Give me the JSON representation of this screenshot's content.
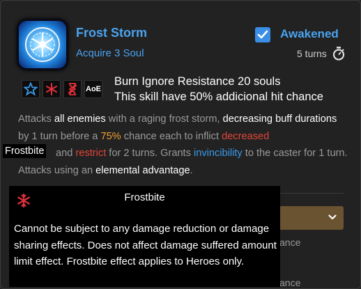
{
  "skill": {
    "name": "Frost Storm",
    "acquire": "Acquire 3 Soul",
    "awakened_label": "Awakened",
    "awakened_checked": true,
    "turns": "5 turns",
    "icon": "frost-snowflake-icon"
  },
  "tags": [
    {
      "name": "freeze-star-icon",
      "label": ""
    },
    {
      "name": "frost-red-icon",
      "label": ""
    },
    {
      "name": "hourglass-icon",
      "label": ""
    },
    {
      "name": "aoe-icon",
      "label": "AoE"
    }
  ],
  "effect": {
    "line1": "Burn Ignore Resistance 20 souls",
    "line2": "This skill have 50% addicional hit chance"
  },
  "description": {
    "t1": "Attacks ",
    "t2": "all enemies",
    "t3": " with a raging frost storm, ",
    "t4": "decreasing buff durations",
    "t5": " by 1 turn before a ",
    "t6": "75%",
    "t7": " chance each to inflict ",
    "t8": "decreased",
    "t9": " and ",
    "t10": "restrict",
    "t11": " for 2 turns. Grants ",
    "t12": "invincibility",
    "t13": " to the caster for 1 turn. Attacks using an ",
    "t14": "elemental advantage",
    "t15": "."
  },
  "hover_label": "Frostbite",
  "background_rows": [
    "ance",
    "ance"
  ],
  "tooltip": {
    "title": "Frostbite",
    "body": "Cannot be subject to any damage reduction or damage sharing effects. Does not affect damage suffered amount limit effect. Frostbite effect applies to Heroes only.",
    "icon": "frostbite-icon"
  },
  "colors": {
    "accent": "#4aa3f0",
    "highlight_orange": "#f0a030",
    "highlight_red": "#e0453a",
    "dropdown": "#6a5330"
  }
}
